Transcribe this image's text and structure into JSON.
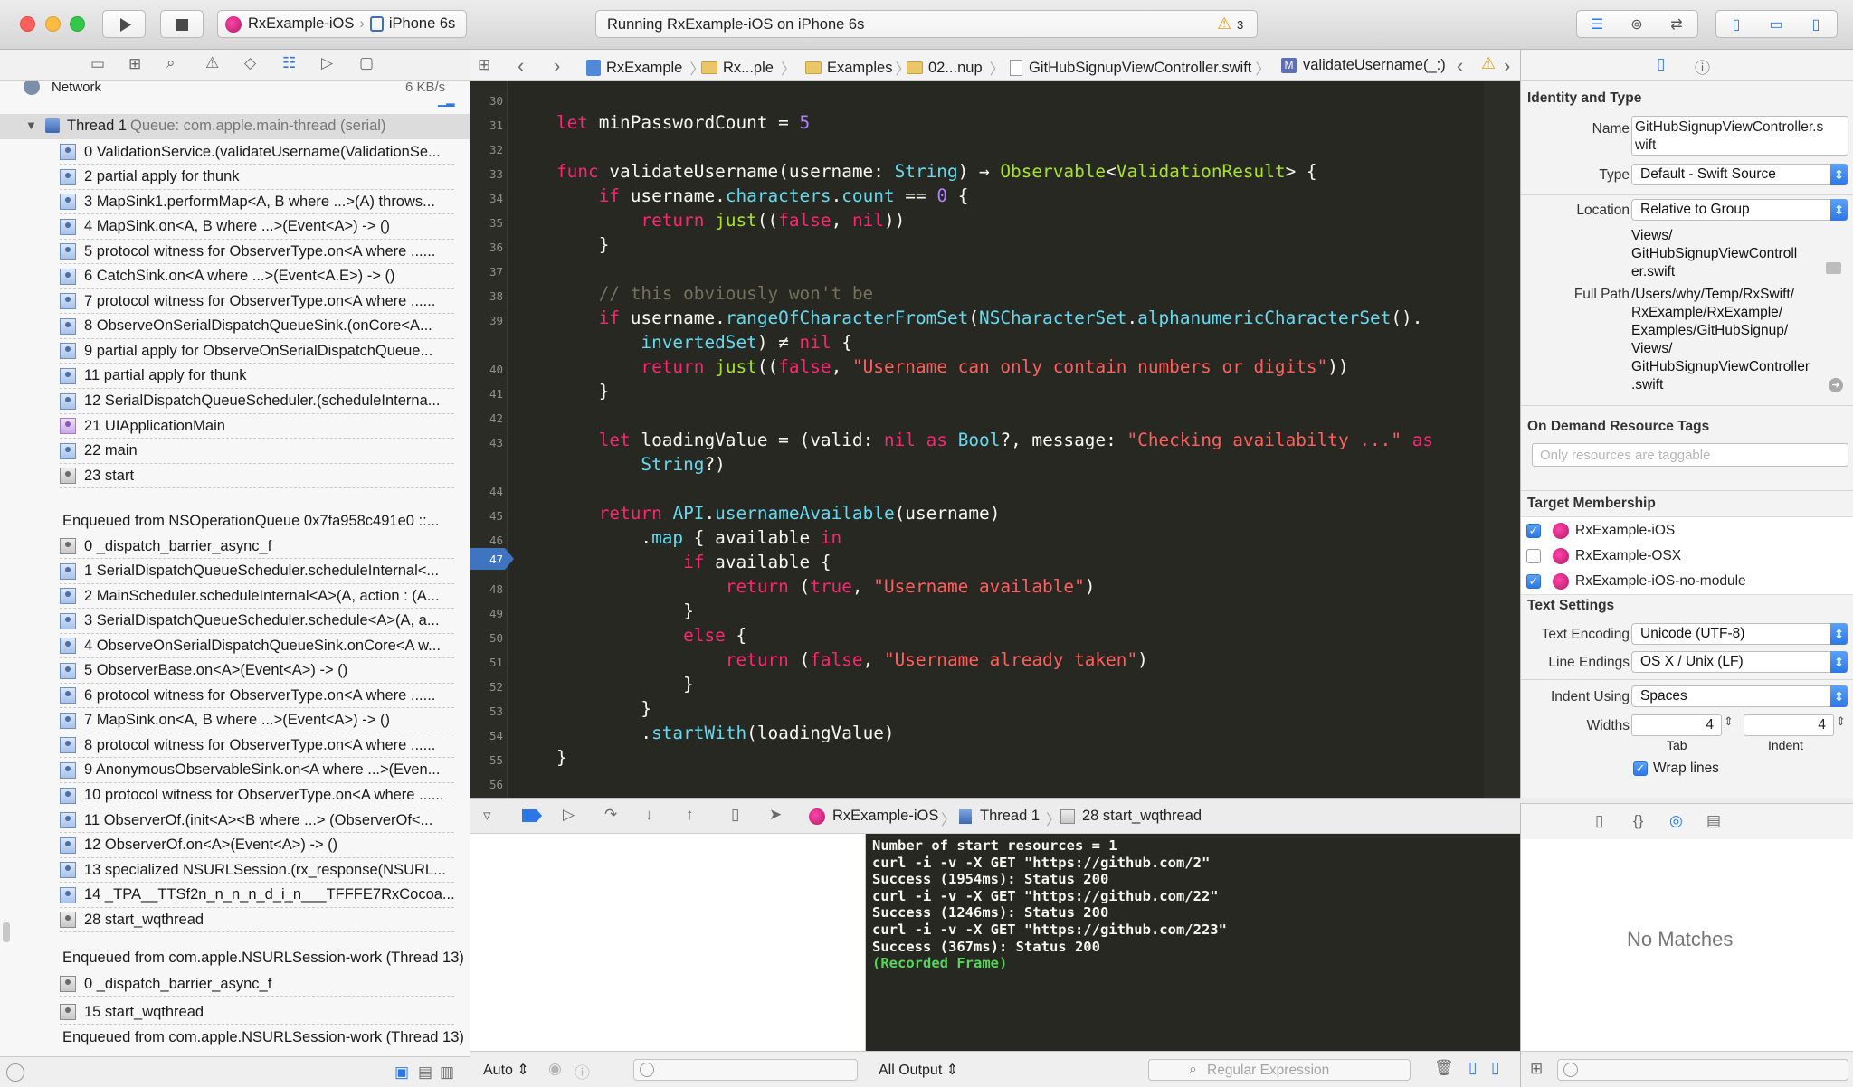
{
  "toolbar": {
    "scheme": "RxExample-iOS",
    "device": "iPhone 6s",
    "activity": "Running RxExample-iOS on iPhone 6s",
    "warning_count": "3"
  },
  "navigator": {
    "network_label": "Network",
    "network_rate": "6 KB/s",
    "thread_header": "Thread 1",
    "thread_queue": "Queue: com.apple.main-thread (serial)",
    "frames_a": [
      {
        "label": "0 ValidationService.(validateUsername(ValidationSe...",
        "icon": "user-frame-icon"
      },
      {
        "label": "2 partial apply for thunk",
        "icon": "user-frame-icon"
      },
      {
        "label": "3 MapSink1.performMap<A, B where ...>(A) throws...",
        "icon": "user-frame-icon"
      },
      {
        "label": "4 MapSink.on<A, B where ...>(Event<A>) -> ()",
        "icon": "user-frame-icon"
      },
      {
        "label": "5 protocol witness for ObserverType.on<A where ......",
        "icon": "user-frame-icon"
      },
      {
        "label": "6 CatchSink.on<A where ...>(Event<A.E>) -> ()",
        "icon": "user-frame-icon"
      },
      {
        "label": "7 protocol witness for ObserverType.on<A where ......",
        "icon": "user-frame-icon"
      },
      {
        "label": "8 ObserveOnSerialDispatchQueueSink.(onCore<A...",
        "icon": "user-frame-icon"
      },
      {
        "label": "9 partial apply for ObserveOnSerialDispatchQueue...",
        "icon": "user-frame-icon"
      },
      {
        "label": "11 partial apply for thunk",
        "icon": "user-frame-icon"
      },
      {
        "label": "12 SerialDispatchQueueScheduler.(scheduleInterna...",
        "icon": "user-frame-icon"
      },
      {
        "label": "21 UIApplicationMain",
        "icon": "uikit-frame-icon"
      },
      {
        "label": "22 main",
        "icon": "user-frame-icon"
      },
      {
        "label": "23 start",
        "icon": "system-frame-icon"
      }
    ],
    "enqueued_1": "Enqueued from NSOperationQueue 0x7fa958c491e0 ::...",
    "frames_b": [
      {
        "label": "0 _dispatch_barrier_async_f",
        "icon": "system-frame-icon"
      },
      {
        "label": "1 SerialDispatchQueueScheduler.scheduleInternal<...",
        "icon": "user-frame-icon"
      },
      {
        "label": "2 MainScheduler.scheduleInternal<A>(A, action : (A...",
        "icon": "user-frame-icon"
      },
      {
        "label": "3 SerialDispatchQueueScheduler.schedule<A>(A, a...",
        "icon": "user-frame-icon"
      },
      {
        "label": "4 ObserveOnSerialDispatchQueueSink.onCore<A w...",
        "icon": "user-frame-icon"
      },
      {
        "label": "5 ObserverBase.on<A>(Event<A>) -> ()",
        "icon": "user-frame-icon"
      },
      {
        "label": "6 protocol witness for ObserverType.on<A where ......",
        "icon": "user-frame-icon"
      },
      {
        "label": "7 MapSink.on<A, B where ...>(Event<A>) -> ()",
        "icon": "user-frame-icon"
      },
      {
        "label": "8 protocol witness for ObserverType.on<A where ......",
        "icon": "user-frame-icon"
      },
      {
        "label": "9 AnonymousObservableSink.on<A where ...>(Even...",
        "icon": "user-frame-icon"
      },
      {
        "label": "10 protocol witness for ObserverType.on<A where ......",
        "icon": "user-frame-icon"
      },
      {
        "label": "11 ObserverOf.(init<A><B where ...> (ObserverOf<...",
        "icon": "user-frame-icon"
      },
      {
        "label": "12 ObserverOf.on<A>(Event<A>) -> ()",
        "icon": "user-frame-icon"
      },
      {
        "label": "13 specialized NSURLSession.(rx_response(NSURL...",
        "icon": "user-frame-icon"
      },
      {
        "label": "14 _TPA__TTSf2n_n_n_n_d_i_n___TFFFE7RxCocoa...",
        "icon": "user-frame-icon"
      },
      {
        "label": "28 start_wqthread",
        "icon": "system-frame-icon"
      }
    ],
    "enqueued_2": "Enqueued from com.apple.NSURLSession-work (Thread 13)",
    "frames_c": [
      {
        "label": "0 _dispatch_barrier_async_f",
        "icon": "system-frame-icon"
      },
      {
        "label": "15 start_wqthread",
        "icon": "system-frame-icon"
      }
    ],
    "enqueued_3": "Enqueued from com.apple.NSURLSession-work (Thread 13)"
  },
  "jumpbar": {
    "crumbs": [
      "RxExample",
      "Rx...ple",
      "Examples",
      "02...nup",
      "GitHubSignupViewController.swift",
      "validateUsername(_:)"
    ]
  },
  "editor": {
    "line_numbers": [
      "30",
      "31",
      "32",
      "33",
      "34",
      "35",
      "36",
      "37",
      "38",
      "39",
      "40",
      "41",
      "42",
      "43",
      "44",
      "45",
      "46",
      "47",
      "48",
      "49",
      "50",
      "51",
      "52",
      "53",
      "54",
      "55",
      "56"
    ],
    "current_line": "47"
  },
  "debugbar": {
    "scheme": "RxExample-iOS",
    "thread": "Thread 1",
    "frame": "28 start_wqthread"
  },
  "console": {
    "lines": [
      "Number of start resources = 1",
      "curl -i -v -X GET \"https://github.com/2\"",
      "Success (1954ms): Status 200",
      "curl -i -v -X GET \"https://github.com/22\"",
      "Success (1246ms): Status 200",
      "curl -i -v -X GET \"https://github.com/223\"",
      "Success (367ms): Status 200"
    ],
    "recorded": "(Recorded Frame)",
    "auto_label": "Auto ⇕",
    "output_label": "All Output ⇕",
    "filter_placeholder": "Regular Expression"
  },
  "inspector": {
    "identity_title": "Identity and Type",
    "name_label": "Name",
    "name_value": [
      "GitHubSignupViewController.s",
      "wift"
    ],
    "type_label": "Type",
    "type_value": "Default - Swift Source",
    "location_label": "Location",
    "location_value": "Relative to Group",
    "location_path": [
      "Views/",
      "GitHubSignupViewControll",
      "er.swift"
    ],
    "fullpath_label": "Full Path",
    "fullpath_value": [
      "/Users/why/Temp/RxSwift/",
      "RxExample/RxExample/",
      "Examples/GitHubSignup/",
      "Views/",
      "GitHubSignupViewController",
      ".swift"
    ],
    "ondemand_title": "On Demand Resource Tags",
    "ondemand_placeholder": "Only resources are taggable",
    "target_title": "Target Membership",
    "targets": [
      {
        "name": "RxExample-iOS",
        "checked": true
      },
      {
        "name": "RxExample-OSX",
        "checked": false
      },
      {
        "name": "RxExample-iOS-no-module",
        "checked": true
      }
    ],
    "text_title": "Text Settings",
    "encoding_label": "Text Encoding",
    "encoding_value": "Unicode (UTF-8)",
    "endings_label": "Line Endings",
    "endings_value": "OS X / Unix (LF)",
    "indent_label": "Indent Using",
    "indent_value": "Spaces",
    "widths_label": "Widths",
    "tab_width": "4",
    "indent_width": "4",
    "tab_label": "Tab",
    "indent_sublabel": "Indent",
    "wrap_label": "Wrap lines"
  },
  "library": {
    "empty_text": "No Matches"
  },
  "colors": {
    "editor_bg": "#272822",
    "keyword": "#f92672",
    "type": "#66d9ef",
    "string": "#e6db74",
    "accent": "#2c77e6"
  }
}
